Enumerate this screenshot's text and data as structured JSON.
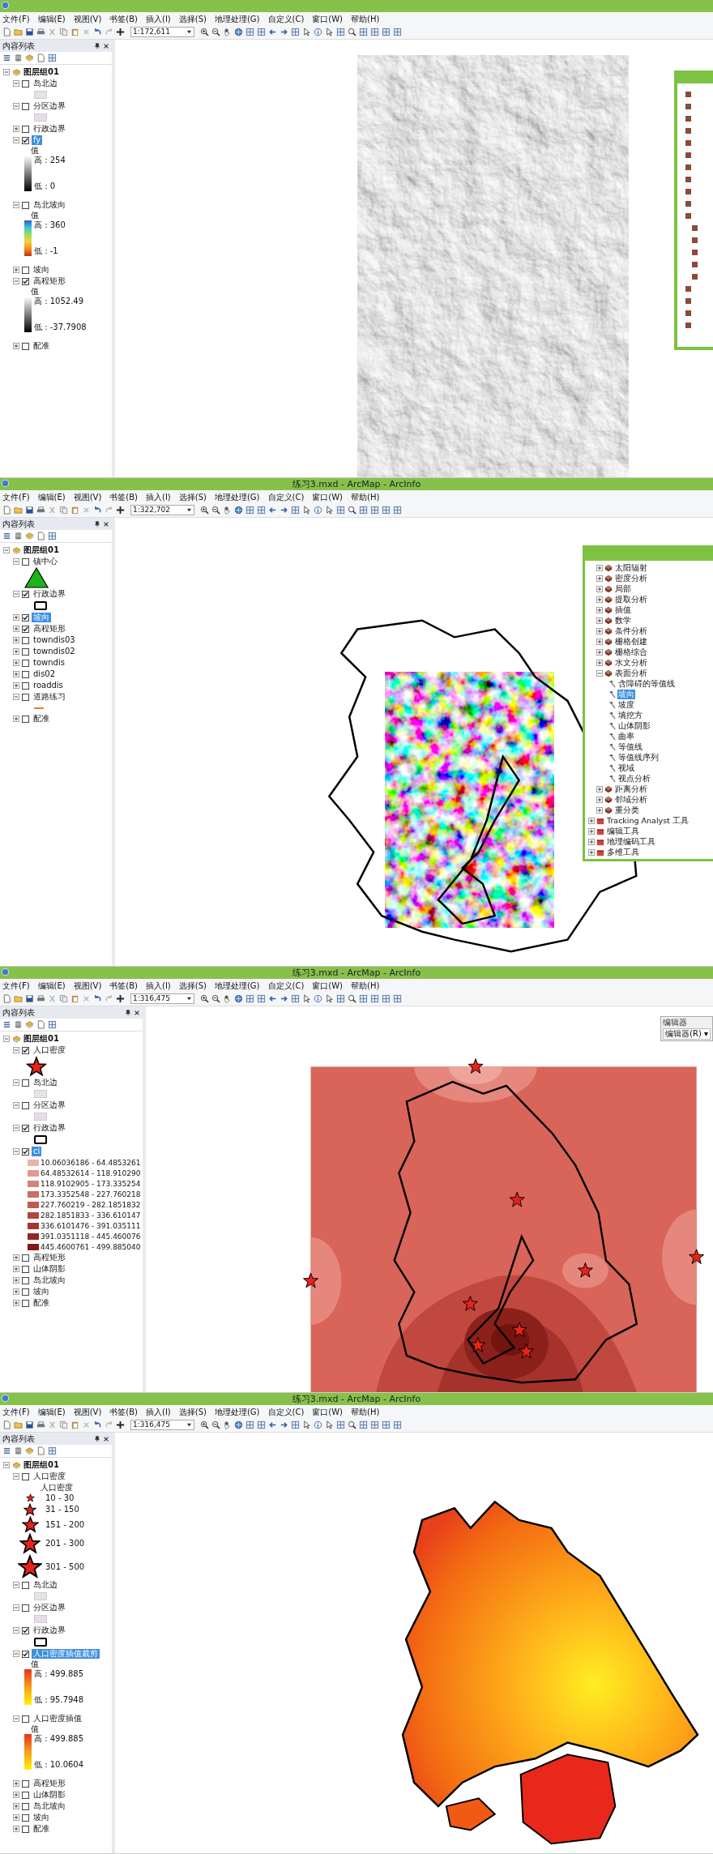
{
  "panels": [
    {
      "menus": [
        "文件(F)",
        "编辑(E)",
        "视图(V)",
        "书签(B)",
        "插入(I)",
        "选择(S)",
        "地理处理(G)",
        "自定义(C)",
        "窗口(W)",
        "帮助(H)"
      ],
      "scale": "1:172,611",
      "toc": {
        "title": "内容列表",
        "group": {
          "label": "图层组01",
          "expanded": true,
          "layers": [
            {
              "label": "岛北边",
              "checked": false,
              "expanded": true,
              "selected": false,
              "legend": [
                {
                  "kind": "swatch",
                  "color": "#e4e4e4"
                }
              ]
            },
            {
              "label": "分区边界",
              "checked": false,
              "expanded": true,
              "selected": false,
              "legend": [
                {
                  "kind": "swatch",
                  "color": "#e6dcea"
                }
              ]
            },
            {
              "label": "行政边界",
              "checked": false,
              "expanded": false,
              "selected": false
            },
            {
              "label": "fy",
              "checked": true,
              "expanded": true,
              "selected": true,
              "legend": [
                {
                  "kind": "gray-ramp",
                  "heading": "值",
                  "high": "高 : 254",
                  "low": "低 : 0"
                }
              ]
            },
            {
              "label": "岛北坡向",
              "checked": false,
              "expanded": true,
              "selected": false,
              "legend": [
                {
                  "kind": "spectrum-ramp",
                  "heading": "值",
                  "high": "高 : 360",
                  "low": "低 : -1"
                }
              ]
            },
            {
              "label": "坡向",
              "checked": false,
              "expanded": false,
              "selected": false
            },
            {
              "label": "高程矩形",
              "checked": true,
              "expanded": true,
              "selected": false,
              "legend": [
                {
                  "kind": "gray-ramp",
                  "heading": "值",
                  "high": "高 : 1052.49",
                  "low": "低 : -37.7908"
                }
              ]
            },
            {
              "label": "配准",
              "checked": false,
              "expanded": false,
              "selected": false
            }
          ]
        }
      },
      "map": {
        "kind": "hillshade"
      },
      "toolbox": {
        "kind": "clipped"
      }
    },
    {
      "title": "练习3.mxd - ArcMap - ArcInfo",
      "menus": [
        "文件(F)",
        "编辑(E)",
        "视图(V)",
        "书签(B)",
        "插入(I)",
        "选择(S)",
        "地理处理(G)",
        "自定义(C)",
        "窗口(W)",
        "帮助(H)"
      ],
      "scale": "1:322,702",
      "toc": {
        "title": "内容列表",
        "group": {
          "label": "图层组01",
          "expanded": true,
          "layers": [
            {
              "label": "镇中心",
              "checked": false,
              "expanded": true,
              "selected": false,
              "legend": [
                {
                  "kind": "triangle"
                }
              ]
            },
            {
              "label": "行政边界",
              "checked": true,
              "expanded": true,
              "selected": false,
              "legend": [
                {
                  "kind": "outline"
                }
              ]
            },
            {
              "label": "坡向",
              "checked": true,
              "expanded": false,
              "selected": true
            },
            {
              "label": "高程矩形",
              "checked": true,
              "expanded": false,
              "selected": false
            },
            {
              "label": "towndis03",
              "checked": false,
              "expanded": false,
              "selected": false
            },
            {
              "label": "towndis02",
              "checked": false,
              "expanded": false,
              "selected": false
            },
            {
              "label": "towndis",
              "checked": false,
              "expanded": false,
              "selected": false
            },
            {
              "label": "dis02",
              "checked": false,
              "expanded": false,
              "selected": false
            },
            {
              "label": "roaddis",
              "checked": false,
              "expanded": false,
              "selected": false
            },
            {
              "label": "道路练习",
              "checked": false,
              "expanded": true,
              "selected": false,
              "legend": [
                {
                  "kind": "line"
                }
              ]
            },
            {
              "label": "配准",
              "checked": false,
              "expanded": false,
              "selected": false
            }
          ]
        }
      },
      "map": {
        "kind": "aspect"
      },
      "toolbox": {
        "kind": "tree",
        "items": [
          {
            "kind": "toolset",
            "label": "太阳辐射",
            "expanded": false
          },
          {
            "kind": "toolset",
            "label": "密度分析",
            "expanded": false
          },
          {
            "kind": "toolset",
            "label": "局部",
            "expanded": false
          },
          {
            "kind": "toolset",
            "label": "提取分析",
            "expanded": false
          },
          {
            "kind": "toolset",
            "label": "插值",
            "expanded": false
          },
          {
            "kind": "toolset",
            "label": "数学",
            "expanded": false
          },
          {
            "kind": "toolset",
            "label": "条件分析",
            "expanded": false
          },
          {
            "kind": "toolset",
            "label": "栅格创建",
            "expanded": false
          },
          {
            "kind": "toolset",
            "label": "栅格综合",
            "expanded": false
          },
          {
            "kind": "toolset",
            "label": "水文分析",
            "expanded": false
          },
          {
            "kind": "toolset",
            "label": "表面分析",
            "expanded": true,
            "children": [
              {
                "label": "含障碍的等值线",
                "selected": false
              },
              {
                "label": "坡向",
                "selected": true
              },
              {
                "label": "坡度",
                "selected": false
              },
              {
                "label": "填挖方",
                "selected": false
              },
              {
                "label": "山体阴影",
                "selected": false
              },
              {
                "label": "曲率",
                "selected": false
              },
              {
                "label": "等值线",
                "selected": false
              },
              {
                "label": "等值线序列",
                "selected": false
              },
              {
                "label": "视域",
                "selected": false
              },
              {
                "label": "视点分析",
                "selected": false
              }
            ]
          },
          {
            "kind": "toolset",
            "label": "距离分析",
            "expanded": false
          },
          {
            "kind": "toolset",
            "label": "邻域分析",
            "expanded": false
          },
          {
            "kind": "toolset",
            "label": "重分类",
            "expanded": false
          },
          {
            "kind": "toolbox",
            "label": "Tracking Analyst 工具",
            "expanded": false
          },
          {
            "kind": "toolbox",
            "label": "编辑工具",
            "expanded": false
          },
          {
            "kind": "toolbox",
            "label": "地理编码工具",
            "expanded": false
          },
          {
            "kind": "toolbox",
            "label": "多维工具",
            "expanded": false
          }
        ]
      }
    },
    {
      "title": "练习3.mxd - ArcMap - ArcInfo",
      "menus": [
        "文件(F)",
        "编辑(E)",
        "视图(V)",
        "书签(B)",
        "插入(I)",
        "选择(S)",
        "地理处理(G)",
        "自定义(C)",
        "窗口(W)",
        "帮助(H)"
      ],
      "scale": "1:316,475",
      "toc": {
        "title": "内容列表",
        "group": {
          "label": "图层组01",
          "expanded": true,
          "layers": [
            {
              "label": "人口密度",
              "checked": true,
              "expanded": true,
              "selected": false,
              "legend": [
                {
                  "kind": "star"
                }
              ]
            },
            {
              "label": "岛北边",
              "checked": false,
              "expanded": true,
              "selected": false,
              "legend": [
                {
                  "kind": "swatch",
                  "color": "#e4e4e4"
                }
              ]
            },
            {
              "label": "分区边界",
              "checked": false,
              "expanded": true,
              "selected": false,
              "legend": [
                {
                  "kind": "swatch",
                  "color": "#e6dcea"
                }
              ]
            },
            {
              "label": "行政边界",
              "checked": true,
              "expanded": true,
              "selected": false,
              "legend": [
                {
                  "kind": "outline"
                }
              ]
            },
            {
              "label": "ci",
              "checked": true,
              "expanded": true,
              "selected": true,
              "legend": [
                {
                  "kind": "class",
                  "color": "#e9b3ad",
                  "label": "10.06036186 - 64.4853261"
                },
                {
                  "kind": "class",
                  "color": "#e09a92",
                  "label": "64.48532614 - 118.910290"
                },
                {
                  "kind": "class",
                  "color": "#d6837a",
                  "label": "118.9102905 - 173.335254"
                },
                {
                  "kind": "class",
                  "color": "#cc6e64",
                  "label": "173.3352548 - 227.760218"
                },
                {
                  "kind": "class",
                  "color": "#c05a50",
                  "label": "227.760219 - 282.1851832"
                },
                {
                  "kind": "class",
                  "color": "#b2473e",
                  "label": "282.1851833 - 336.610147"
                },
                {
                  "kind": "class",
                  "color": "#a3362e",
                  "label": "336.6101476 - 391.035111"
                },
                {
                  "kind": "class",
                  "color": "#942622",
                  "label": "391.0351118 - 445.460076"
                },
                {
                  "kind": "class",
                  "color": "#841818",
                  "label": "445.4600761 - 499.885040"
                }
              ]
            },
            {
              "label": "高程矩形",
              "checked": false,
              "expanded": false,
              "selected": false
            },
            {
              "label": "山体阴影",
              "checked": false,
              "expanded": false,
              "selected": false
            },
            {
              "label": "岛北坡向",
              "checked": false,
              "expanded": false,
              "selected": false
            },
            {
              "label": "坡向",
              "checked": false,
              "expanded": false,
              "selected": false
            },
            {
              "label": "配准",
              "checked": false,
              "expanded": false,
              "selected": false
            }
          ]
        }
      },
      "map": {
        "kind": "density-classes"
      },
      "editor": {
        "title": "编辑器",
        "menu": "编辑器(R) ▾"
      }
    },
    {
      "title": "练习3.mxd - ArcMap - ArcInfo",
      "menus": [
        "文件(F)",
        "编辑(E)",
        "视图(V)",
        "书签(B)",
        "插入(I)",
        "选择(S)",
        "地理处理(G)",
        "自定义(C)",
        "窗口(W)",
        "帮助(H)"
      ],
      "scale": "1:316,475",
      "toc": {
        "title": "内容列表",
        "group": {
          "label": "图层组01",
          "expanded": true,
          "layers": [
            {
              "label": "人口密度",
              "checked": false,
              "expanded": true,
              "selected": false,
              "legend": [
                {
                  "kind": "heading",
                  "label": "人口密度"
                },
                {
                  "kind": "graduated-star",
                  "label": "10 - 30"
                },
                {
                  "kind": "graduated-star",
                  "label": "31 - 150"
                },
                {
                  "kind": "graduated-star",
                  "label": "151 - 200"
                },
                {
                  "kind": "graduated-star",
                  "label": "201 - 300"
                },
                {
                  "kind": "graduated-star",
                  "label": "301 - 500"
                }
              ]
            },
            {
              "label": "岛北边",
              "checked": false,
              "expanded": true,
              "selected": false,
              "legend": [
                {
                  "kind": "swatch",
                  "color": "#e4e4e4"
                }
              ]
            },
            {
              "label": "分区边界",
              "checked": false,
              "expanded": true,
              "selected": false,
              "legend": [
                {
                  "kind": "swatch",
                  "color": "#e6dcea"
                }
              ]
            },
            {
              "label": "行政边界",
              "checked": true,
              "expanded": true,
              "selected": false,
              "legend": [
                {
                  "kind": "outline"
                }
              ]
            },
            {
              "label": "人口密度插值裁剪",
              "checked": true,
              "expanded": true,
              "selected": true,
              "legend": [
                {
                  "kind": "heat-ramp",
                  "heading": "值",
                  "high": "高 : 499.885",
                  "low": "低 : 95.7948"
                }
              ]
            },
            {
              "label": "人口密度插值",
              "checked": false,
              "expanded": true,
              "selected": false,
              "legend": [
                {
                  "kind": "heat-ramp",
                  "heading": "值",
                  "high": "高 : 499.885",
                  "low": "低 : 10.0604"
                }
              ]
            },
            {
              "label": "高程矩形",
              "checked": false,
              "expanded": false,
              "selected": false
            },
            {
              "label": "山体阴影",
              "checked": false,
              "expanded": false,
              "selected": false
            },
            {
              "label": "岛北坡向",
              "checked": false,
              "expanded": false,
              "selected": false
            },
            {
              "label": "坡向",
              "checked": false,
              "expanded": false,
              "selected": false
            },
            {
              "label": "配准",
              "checked": false,
              "expanded": false,
              "selected": false
            }
          ]
        }
      },
      "map": {
        "kind": "density-surface"
      }
    }
  ]
}
